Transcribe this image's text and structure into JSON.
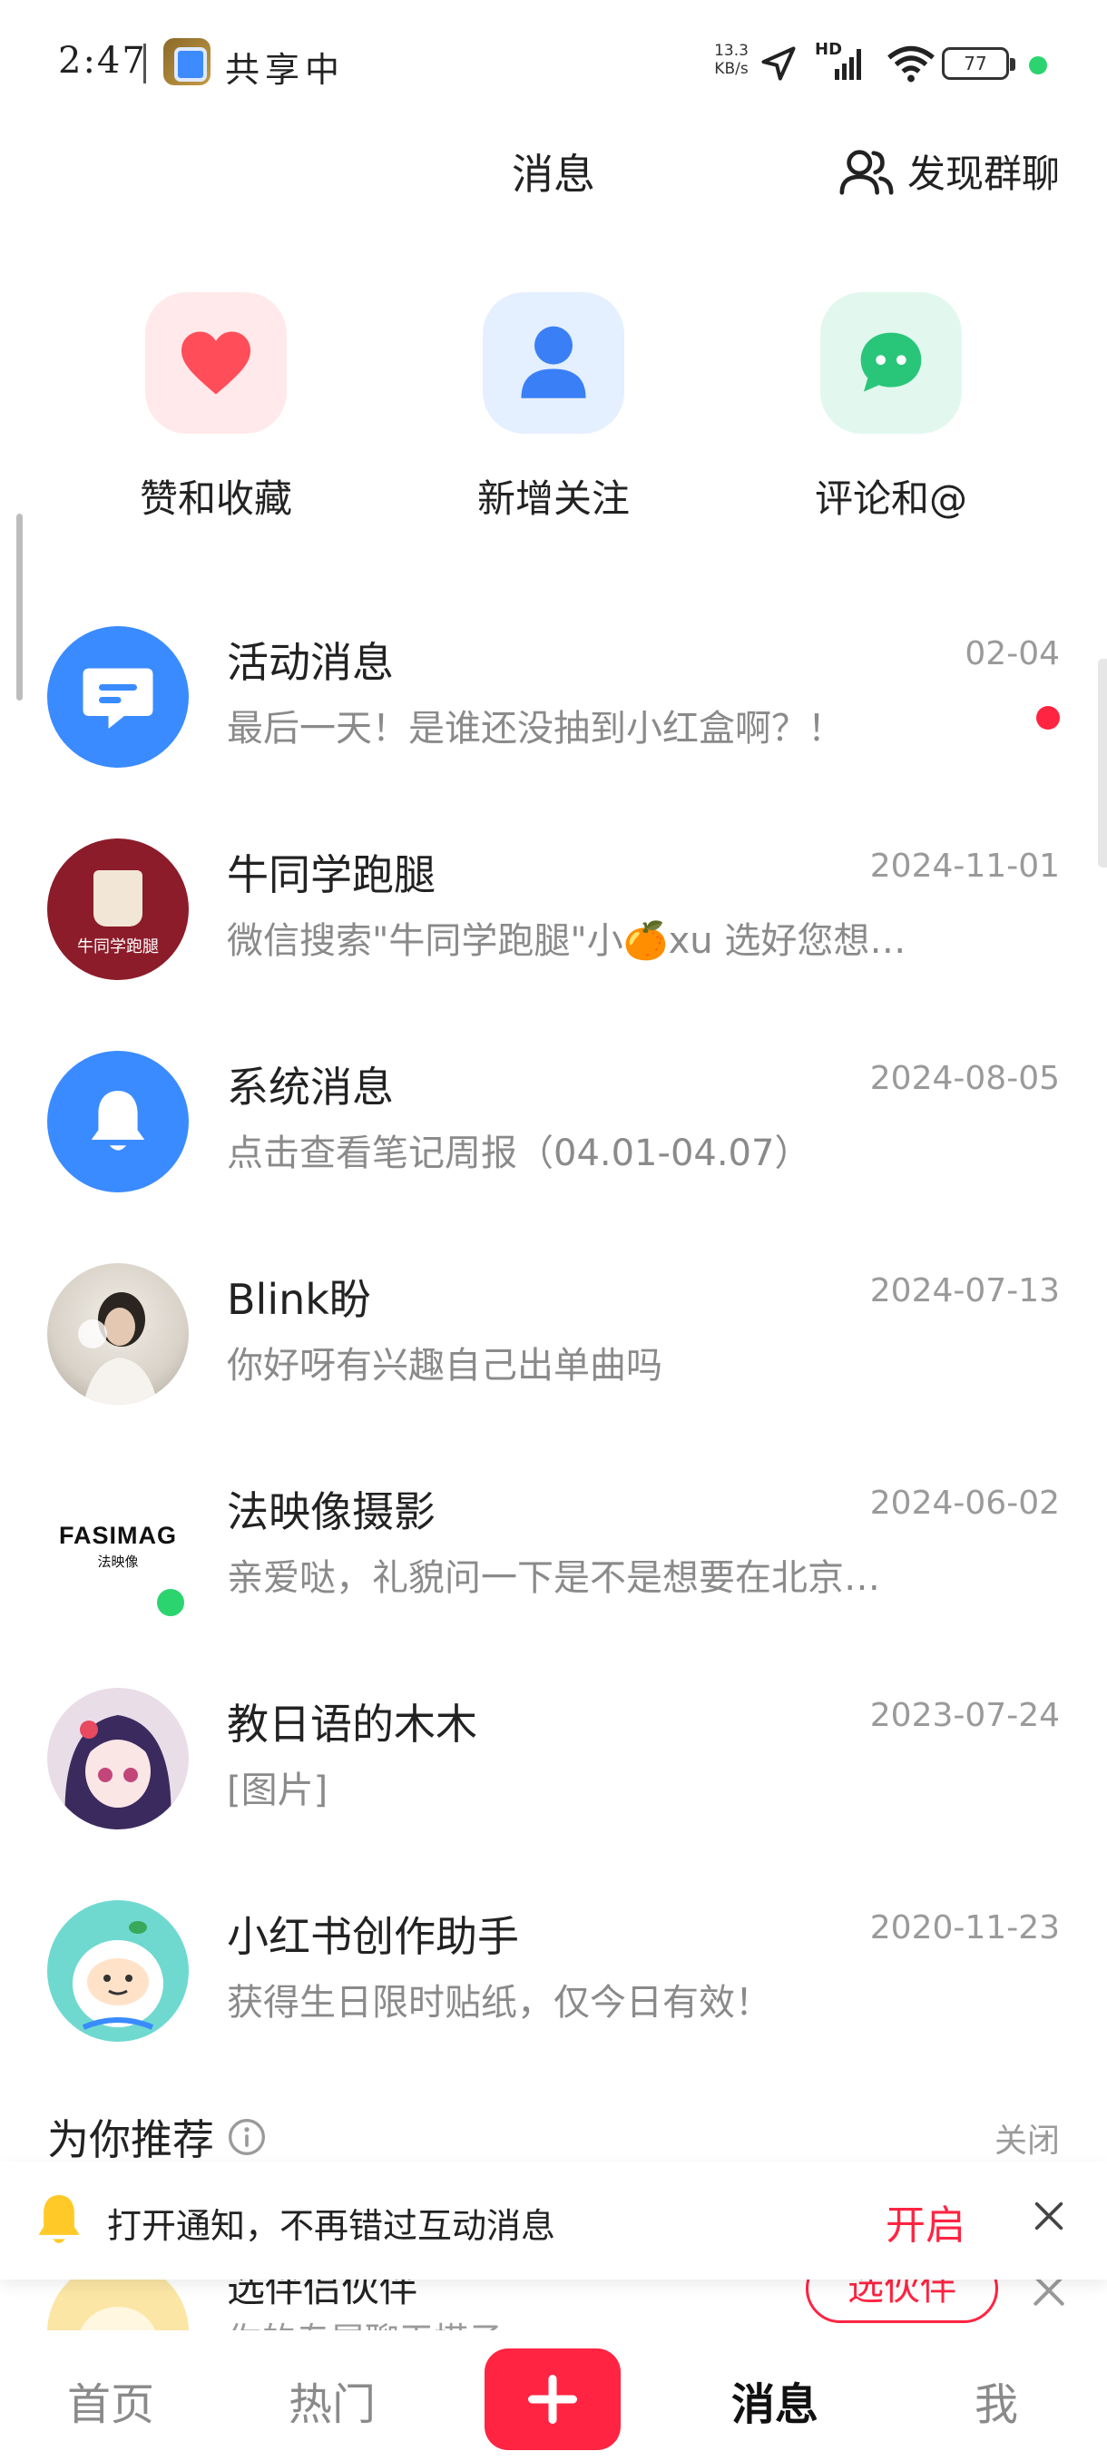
{
  "status_bar": {
    "time": "2:47",
    "sharing_label": "共享中",
    "net_speed_value": "13.3",
    "net_speed_unit": "KB/s",
    "network_label": "HD",
    "battery": "77"
  },
  "header": {
    "title": "消息",
    "discover_label": "发现群聊"
  },
  "categories": [
    {
      "label": "赞和收藏",
      "icon": "heart-icon",
      "bg": "#ffe9ea",
      "color": "#ff4d5a"
    },
    {
      "label": "新增关注",
      "icon": "person-icon",
      "bg": "#e4efff",
      "color": "#3a7ff6"
    },
    {
      "label": "评论和@",
      "icon": "chat-icon",
      "bg": "#e2f8ee",
      "color": "#29c67a"
    }
  ],
  "messages": [
    {
      "name": "活动消息",
      "date": "02-04",
      "preview": "最后一天！是谁还没抽到小红盒啊？！",
      "avatar": "activity-icon"
    },
    {
      "name": "牛同学跑腿",
      "date": "2024-11-01",
      "preview": "微信搜索\"牛同学跑腿\"小🍊xu  选好您想…",
      "avatar": "brand-logo",
      "avatar_text": "牛同学跑腿"
    },
    {
      "name": "系统消息",
      "date": "2024-08-05",
      "preview": "点击查看笔记周报（04.01-04.07）",
      "avatar": "bell-icon"
    },
    {
      "name": "Blink盼",
      "date": "2024-07-13",
      "preview": "你好呀有兴趣自己出单曲吗",
      "avatar": "user-photo"
    },
    {
      "name": "法映像摄影",
      "date": "2024-06-02",
      "preview": "亲爱哒，礼貌问一下是不是想要在北京…",
      "avatar": "brand-logo",
      "avatar_text": "FASIMAG",
      "avatar_sub": "法映像"
    },
    {
      "name": "教日语的木木",
      "date": "2023-07-24",
      "preview": "[图片]",
      "avatar": "anime-avatar"
    },
    {
      "name": "小红书创作助手",
      "date": "2020-11-23",
      "preview": "获得生日限时贴纸，仅今日有效！",
      "avatar": "mascot-avatar"
    }
  ],
  "recommend": {
    "title": "为你推荐",
    "close_label": "关闭",
    "partial_item": {
      "name": "选伴侣伙伴",
      "sub": "你的专属聊天搭子",
      "button": "选伙伴"
    }
  },
  "notify_banner": {
    "text": "打开通知，不再错过互动消息",
    "button": "开启"
  },
  "bottom_nav": {
    "home": "首页",
    "hot": "热门",
    "messages": "消息",
    "me": "我"
  },
  "colors": {
    "accent": "#ff2442",
    "online": "#2bd46f",
    "blue": "#3a8bff"
  }
}
